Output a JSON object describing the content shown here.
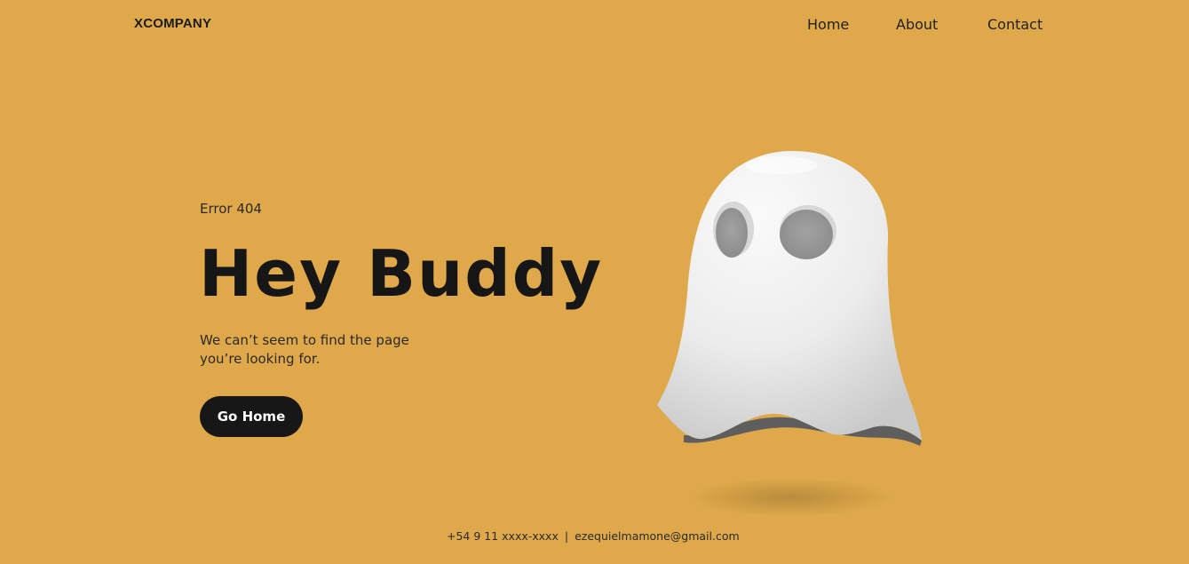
{
  "header": {
    "brand": "XCOMPANY",
    "nav": [
      {
        "label": "Home"
      },
      {
        "label": "About"
      },
      {
        "label": "Contact"
      }
    ]
  },
  "hero": {
    "eyebrow": "Error 404",
    "title": "Hey Buddy",
    "subtitle_line1": "We can’t seem to find the page",
    "subtitle_line2": "you’re looking for.",
    "cta_label": "Go Home"
  },
  "footer": {
    "phone": "+54 9 11 xxxx-xxxx",
    "separator": "|",
    "email": "ezequielmamone@gmail.com"
  },
  "colors": {
    "background": "#DFA94B",
    "text": "#161616",
    "button": "#171717",
    "ghost": "#F2F2F2"
  },
  "illustration": {
    "icon": "ghost-icon"
  }
}
